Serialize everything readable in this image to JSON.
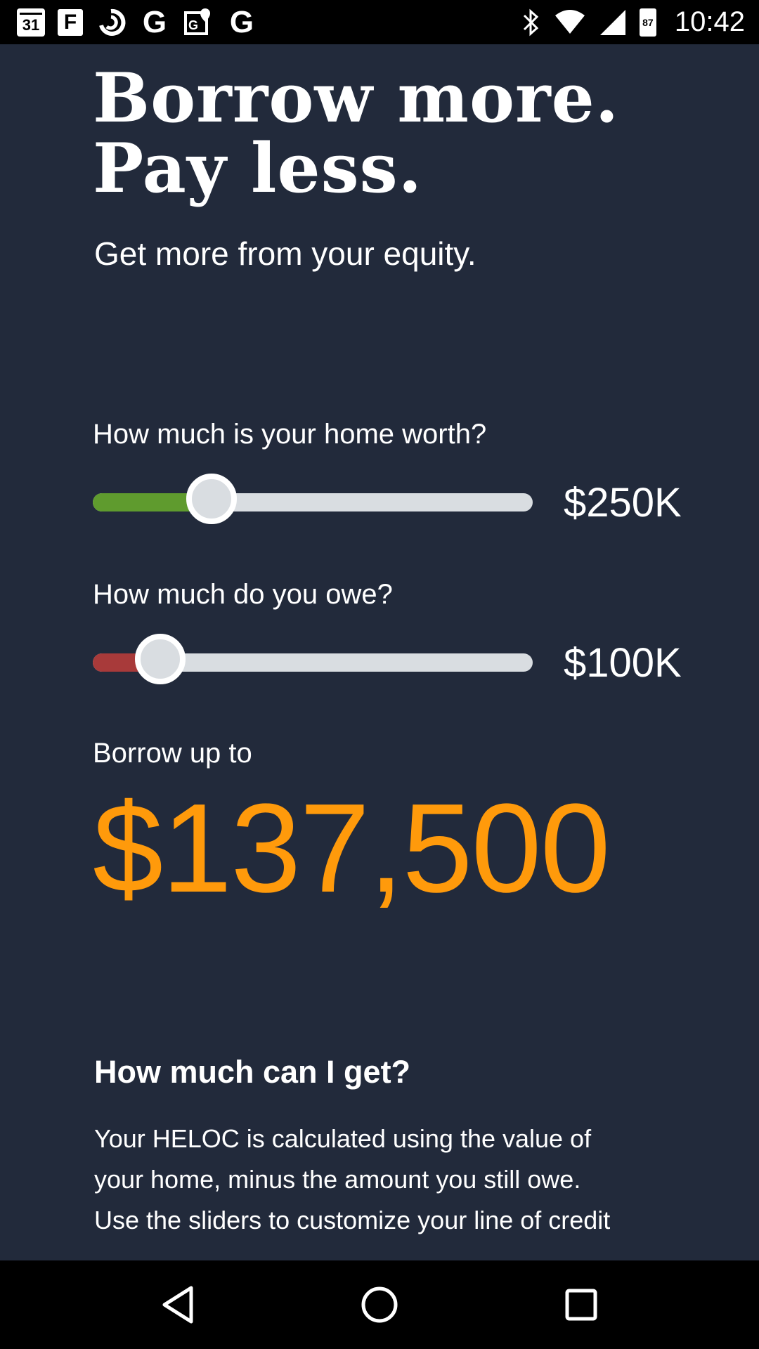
{
  "status_bar": {
    "calendar_day": "31",
    "flipboard": "F",
    "google1": "G",
    "google2": "G",
    "battery_level": "87",
    "time": "10:42",
    "icons": [
      "calendar-icon",
      "flipboard-icon",
      "swirl-icon",
      "google-icon",
      "google-maps-icon",
      "google-icon",
      "bluetooth-icon",
      "wifi-icon",
      "signal-icon",
      "battery-icon"
    ]
  },
  "hero": {
    "title": "Borrow more.\nPay less.",
    "subtitle": "Get more from your equity."
  },
  "home_worth": {
    "label": "How much is your home worth?",
    "value": "$250K",
    "fraction": 0.27,
    "fill_color": "#5f9b2e"
  },
  "owe": {
    "label": "How much do you owe?",
    "value": "$100K",
    "fraction": 0.153,
    "fill_color": "#a83a3a"
  },
  "result": {
    "label": "Borrow up to",
    "amount": "$137,500",
    "color": "#ff9a0b"
  },
  "info": {
    "heading": "How much can I get?",
    "body": "Your HELOC is calculated using the value of your home, minus the amount you still owe. Use the sliders to customize your line of credit amount."
  },
  "nav": [
    "back-icon",
    "home-icon",
    "recents-icon"
  ]
}
